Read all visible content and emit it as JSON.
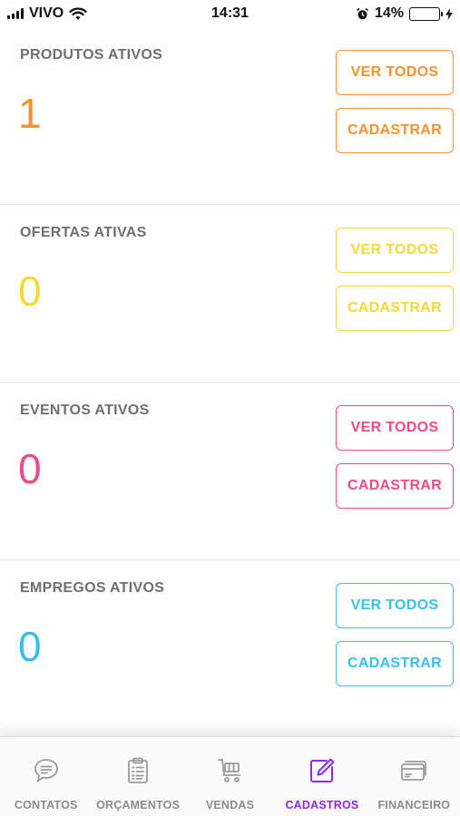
{
  "status": {
    "carrier": "VIVO",
    "time": "14:31",
    "battery": "14%",
    "battery_level": 0.14
  },
  "colors": {
    "orange": "#f2932f",
    "yellow": "#f3d93a",
    "pink": "#ea4c89",
    "cyan": "#3bbfe6",
    "active_nav": "#8c2be2",
    "inactive_nav": "#8c8c8c"
  },
  "sections": [
    {
      "title": "PRODUTOS ATIVOS",
      "count": "1",
      "view_all_label": "VER TODOS",
      "register_label": "CADASTRAR",
      "color": "#f2932f"
    },
    {
      "title": "OFERTAS ATIVAS",
      "count": "0",
      "view_all_label": "VER TODOS",
      "register_label": "CADASTRAR",
      "color": "#f3d93a"
    },
    {
      "title": "EVENTOS ATIVOS",
      "count": "0",
      "view_all_label": "VER TODOS",
      "register_label": "CADASTRAR",
      "color": "#ea4c89"
    },
    {
      "title": "EMPREGOS ATIVOS",
      "count": "0",
      "view_all_label": "VER TODOS",
      "register_label": "CADASTRAR",
      "color": "#3bbfe6"
    }
  ],
  "nav": [
    {
      "label": "CONTATOS",
      "icon": "chat-icon",
      "active": false
    },
    {
      "label": "ORÇAMENTOS",
      "icon": "clipboard-list-icon",
      "active": false
    },
    {
      "label": "VENDAS",
      "icon": "cart-icon",
      "active": false
    },
    {
      "label": "CADASTROS",
      "icon": "edit-icon",
      "active": true
    },
    {
      "label": "FINANCEIRO",
      "icon": "credit-card-icon",
      "active": false
    }
  ]
}
